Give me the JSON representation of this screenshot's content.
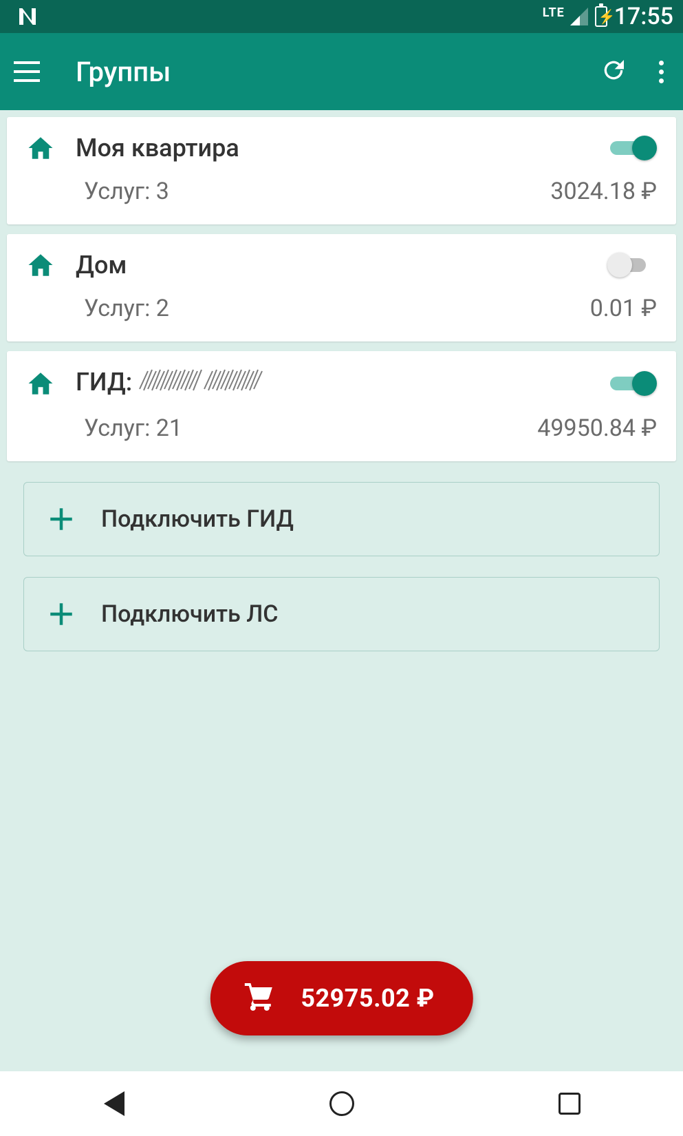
{
  "statusbar": {
    "network_label": "LTE",
    "time": "17:55"
  },
  "appbar": {
    "title": "Группы"
  },
  "groups": [
    {
      "title": "Моя квартира",
      "services_label": "Услуг: 3",
      "amount": "3024.18 ₽",
      "toggle_on": true
    },
    {
      "title": "Дом",
      "services_label": "Услуг: 2",
      "amount": "0.01 ₽",
      "toggle_on": false
    },
    {
      "title_prefix": "ГИД:",
      "title_redacted": true,
      "services_label": "Услуг: 21",
      "amount": "49950.84 ₽",
      "toggle_on": true
    }
  ],
  "actions": {
    "connect_gid": "Подключить ГИД",
    "connect_ls": "Подключить ЛС"
  },
  "cart": {
    "total": "52975.02 ₽"
  }
}
